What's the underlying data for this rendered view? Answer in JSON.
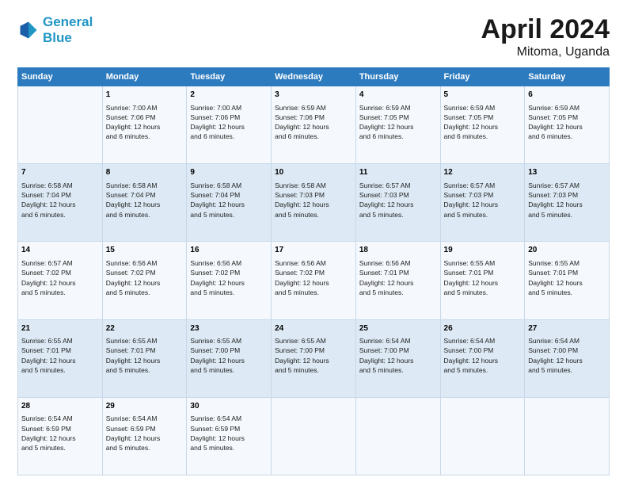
{
  "header": {
    "logo_general": "General",
    "logo_blue": "Blue",
    "main_title": "April 2024",
    "sub_title": "Mitoma, Uganda"
  },
  "columns": [
    "Sunday",
    "Monday",
    "Tuesday",
    "Wednesday",
    "Thursday",
    "Friday",
    "Saturday"
  ],
  "weeks": [
    [
      {
        "day": "",
        "info": ""
      },
      {
        "day": "1",
        "info": "Sunrise: 7:00 AM\nSunset: 7:06 PM\nDaylight: 12 hours\nand 6 minutes."
      },
      {
        "day": "2",
        "info": "Sunrise: 7:00 AM\nSunset: 7:06 PM\nDaylight: 12 hours\nand 6 minutes."
      },
      {
        "day": "3",
        "info": "Sunrise: 6:59 AM\nSunset: 7:06 PM\nDaylight: 12 hours\nand 6 minutes."
      },
      {
        "day": "4",
        "info": "Sunrise: 6:59 AM\nSunset: 7:05 PM\nDaylight: 12 hours\nand 6 minutes."
      },
      {
        "day": "5",
        "info": "Sunrise: 6:59 AM\nSunset: 7:05 PM\nDaylight: 12 hours\nand 6 minutes."
      },
      {
        "day": "6",
        "info": "Sunrise: 6:59 AM\nSunset: 7:05 PM\nDaylight: 12 hours\nand 6 minutes."
      }
    ],
    [
      {
        "day": "7",
        "info": "Sunrise: 6:58 AM\nSunset: 7:04 PM\nDaylight: 12 hours\nand 6 minutes."
      },
      {
        "day": "8",
        "info": "Sunrise: 6:58 AM\nSunset: 7:04 PM\nDaylight: 12 hours\nand 6 minutes."
      },
      {
        "day": "9",
        "info": "Sunrise: 6:58 AM\nSunset: 7:04 PM\nDaylight: 12 hours\nand 5 minutes."
      },
      {
        "day": "10",
        "info": "Sunrise: 6:58 AM\nSunset: 7:03 PM\nDaylight: 12 hours\nand 5 minutes."
      },
      {
        "day": "11",
        "info": "Sunrise: 6:57 AM\nSunset: 7:03 PM\nDaylight: 12 hours\nand 5 minutes."
      },
      {
        "day": "12",
        "info": "Sunrise: 6:57 AM\nSunset: 7:03 PM\nDaylight: 12 hours\nand 5 minutes."
      },
      {
        "day": "13",
        "info": "Sunrise: 6:57 AM\nSunset: 7:03 PM\nDaylight: 12 hours\nand 5 minutes."
      }
    ],
    [
      {
        "day": "14",
        "info": "Sunrise: 6:57 AM\nSunset: 7:02 PM\nDaylight: 12 hours\nand 5 minutes."
      },
      {
        "day": "15",
        "info": "Sunrise: 6:56 AM\nSunset: 7:02 PM\nDaylight: 12 hours\nand 5 minutes."
      },
      {
        "day": "16",
        "info": "Sunrise: 6:56 AM\nSunset: 7:02 PM\nDaylight: 12 hours\nand 5 minutes."
      },
      {
        "day": "17",
        "info": "Sunrise: 6:56 AM\nSunset: 7:02 PM\nDaylight: 12 hours\nand 5 minutes."
      },
      {
        "day": "18",
        "info": "Sunrise: 6:56 AM\nSunset: 7:01 PM\nDaylight: 12 hours\nand 5 minutes."
      },
      {
        "day": "19",
        "info": "Sunrise: 6:55 AM\nSunset: 7:01 PM\nDaylight: 12 hours\nand 5 minutes."
      },
      {
        "day": "20",
        "info": "Sunrise: 6:55 AM\nSunset: 7:01 PM\nDaylight: 12 hours\nand 5 minutes."
      }
    ],
    [
      {
        "day": "21",
        "info": "Sunrise: 6:55 AM\nSunset: 7:01 PM\nDaylight: 12 hours\nand 5 minutes."
      },
      {
        "day": "22",
        "info": "Sunrise: 6:55 AM\nSunset: 7:01 PM\nDaylight: 12 hours\nand 5 minutes."
      },
      {
        "day": "23",
        "info": "Sunrise: 6:55 AM\nSunset: 7:00 PM\nDaylight: 12 hours\nand 5 minutes."
      },
      {
        "day": "24",
        "info": "Sunrise: 6:55 AM\nSunset: 7:00 PM\nDaylight: 12 hours\nand 5 minutes."
      },
      {
        "day": "25",
        "info": "Sunrise: 6:54 AM\nSunset: 7:00 PM\nDaylight: 12 hours\nand 5 minutes."
      },
      {
        "day": "26",
        "info": "Sunrise: 6:54 AM\nSunset: 7:00 PM\nDaylight: 12 hours\nand 5 minutes."
      },
      {
        "day": "27",
        "info": "Sunrise: 6:54 AM\nSunset: 7:00 PM\nDaylight: 12 hours\nand 5 minutes."
      }
    ],
    [
      {
        "day": "28",
        "info": "Sunrise: 6:54 AM\nSunset: 6:59 PM\nDaylight: 12 hours\nand 5 minutes."
      },
      {
        "day": "29",
        "info": "Sunrise: 6:54 AM\nSunset: 6:59 PM\nDaylight: 12 hours\nand 5 minutes."
      },
      {
        "day": "30",
        "info": "Sunrise: 6:54 AM\nSunset: 6:59 PM\nDaylight: 12 hours\nand 5 minutes."
      },
      {
        "day": "",
        "info": ""
      },
      {
        "day": "",
        "info": ""
      },
      {
        "day": "",
        "info": ""
      },
      {
        "day": "",
        "info": ""
      }
    ]
  ]
}
